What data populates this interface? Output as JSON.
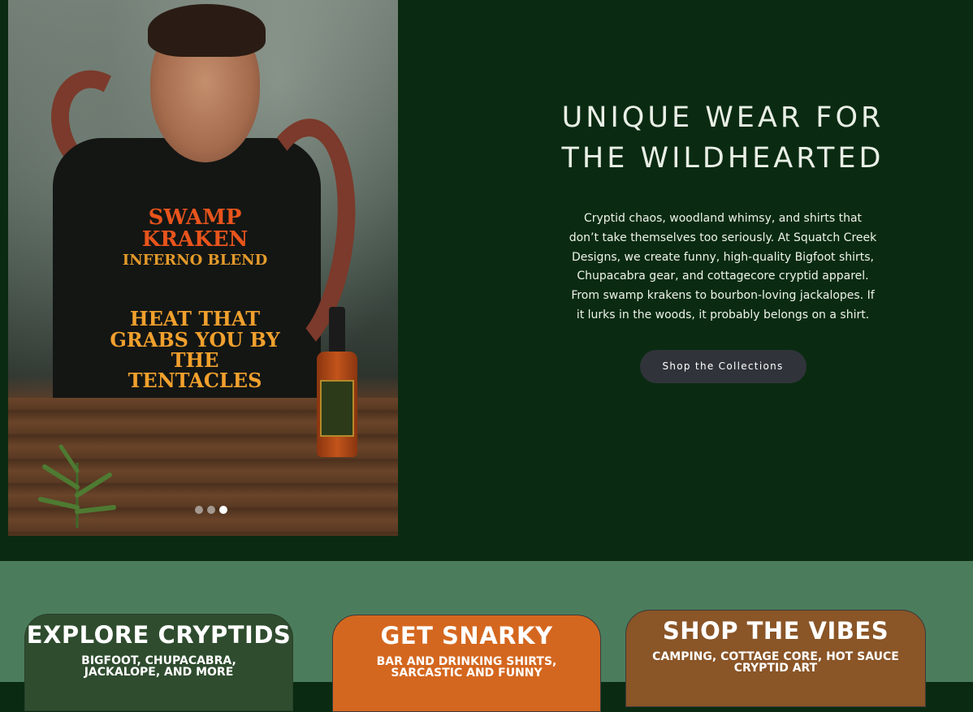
{
  "hero": {
    "title_line1": "UNIQUE WEAR FOR",
    "title_line2": "THE WILDHEARTED",
    "description": "Cryptid chaos, woodland whimsy, and shirts that don’t take themselves too seriously. At Squatch Creek Designs, we create funny, high-quality Bigfoot shirts, Chupacabra gear, and cottagecore cryptid apparel. From swamp krakens to bourbon-loving jackalopes. If it lurks in the woods, it probably belongs on a shirt.",
    "button_label": "Shop the Collections",
    "slider": {
      "slide_count": 3,
      "active_index": 2
    },
    "image": {
      "shirt_line1": "SWAMP KRAKEN",
      "shirt_line2": "INFERNO BLEND",
      "shirt_line3": "HEAT THAT GRABS YOU BY THE TENTACLES"
    }
  },
  "categories": [
    {
      "title": "EXPLORE CRYPTIDS",
      "subtitle": "BIGFOOT, CHUPACABRA, JACKALOPE, AND MORE"
    },
    {
      "title": "GET SNARKY",
      "subtitle": "BAR AND DRINKING SHIRTS, SARCASTIC AND FUNNY"
    },
    {
      "title": "SHOP THE VIBES",
      "subtitle": "CAMPING, COTTAGE CORE, HOT SAUCE CRYPTID ART"
    }
  ],
  "colors": {
    "hero_bg": "#0a2b12",
    "lower_bg": "#4b7d5c",
    "button_bg": "#30343a",
    "card_green": "#2f4c2f",
    "card_orange": "#d4671f",
    "card_brown": "#8a5527"
  }
}
